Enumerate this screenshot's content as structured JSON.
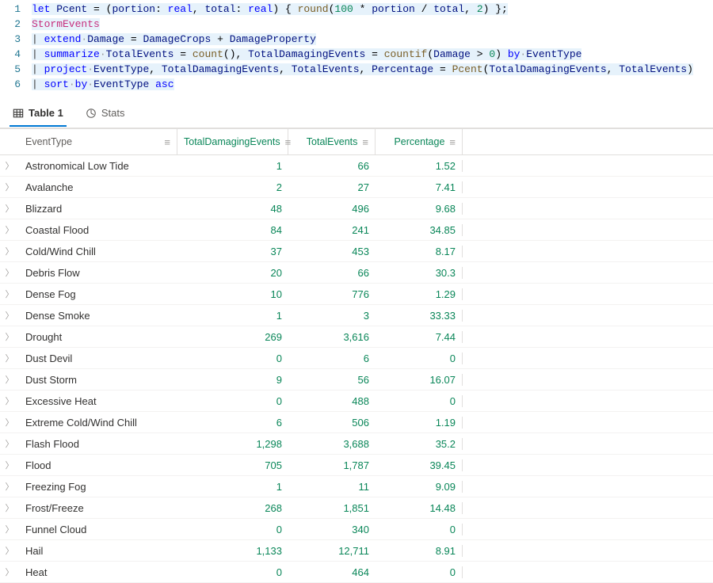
{
  "editor": {
    "lines": [
      {
        "n": "1",
        "tokens": [
          [
            "kw",
            "let"
          ],
          [
            "op",
            " "
          ],
          [
            "ident",
            "Pcent"
          ],
          [
            "op",
            " = ("
          ],
          [
            "ident",
            "portion"
          ],
          [
            "op",
            ": "
          ],
          [
            "kw",
            "real"
          ],
          [
            "op",
            ", "
          ],
          [
            "ident",
            "total"
          ],
          [
            "op",
            ": "
          ],
          [
            "kw",
            "real"
          ],
          [
            "op",
            ") { "
          ],
          [
            "fn",
            "round"
          ],
          [
            "op",
            "("
          ],
          [
            "num",
            "100"
          ],
          [
            "op",
            " * "
          ],
          [
            "ident",
            "portion"
          ],
          [
            "op",
            " / "
          ],
          [
            "ident",
            "total"
          ],
          [
            "op",
            ", "
          ],
          [
            "num",
            "2"
          ],
          [
            "op",
            ") };"
          ]
        ],
        "hl": true
      },
      {
        "n": "2",
        "tokens": [
          [
            "tbl",
            "StormEvents"
          ]
        ],
        "hl": true
      },
      {
        "n": "3",
        "tokens": [
          [
            "pipe",
            "| "
          ],
          [
            "kw",
            "extend"
          ],
          [
            "dot",
            "·"
          ],
          [
            "col",
            "Damage"
          ],
          [
            "op",
            " = "
          ],
          [
            "col",
            "DamageCrops"
          ],
          [
            "op",
            " + "
          ],
          [
            "col",
            "DamageProperty"
          ]
        ],
        "hl": true
      },
      {
        "n": "4",
        "tokens": [
          [
            "pipe",
            "| "
          ],
          [
            "kw",
            "summarize"
          ],
          [
            "dot",
            "·"
          ],
          [
            "col",
            "TotalEvents"
          ],
          [
            "op",
            " = "
          ],
          [
            "fn",
            "count"
          ],
          [
            "op",
            "(), "
          ],
          [
            "col",
            "TotalDamagingEvents"
          ],
          [
            "op",
            " = "
          ],
          [
            "fn",
            "countif"
          ],
          [
            "op",
            "("
          ],
          [
            "col",
            "Damage"
          ],
          [
            "op",
            " > "
          ],
          [
            "num",
            "0"
          ],
          [
            "op",
            ") "
          ],
          [
            "kw",
            "by"
          ],
          [
            "dot",
            "·"
          ],
          [
            "col",
            "EventType"
          ]
        ],
        "hl": true
      },
      {
        "n": "5",
        "tokens": [
          [
            "pipe",
            "| "
          ],
          [
            "kw",
            "project"
          ],
          [
            "dot",
            "·"
          ],
          [
            "col",
            "EventType"
          ],
          [
            "op",
            ", "
          ],
          [
            "col",
            "TotalDamagingEvents"
          ],
          [
            "op",
            ", "
          ],
          [
            "col",
            "TotalEvents"
          ],
          [
            "op",
            ", "
          ],
          [
            "col",
            "Percentage"
          ],
          [
            "op",
            " = "
          ],
          [
            "fn",
            "Pcent"
          ],
          [
            "op",
            "("
          ],
          [
            "col",
            "TotalDamagingEvents"
          ],
          [
            "op",
            ", "
          ],
          [
            "col",
            "TotalEvents"
          ],
          [
            "op",
            ")"
          ]
        ],
        "hl": true
      },
      {
        "n": "6",
        "tokens": [
          [
            "pipe",
            "| "
          ],
          [
            "kw",
            "sort"
          ],
          [
            "dot",
            "·"
          ],
          [
            "kw",
            "by"
          ],
          [
            "dot",
            "·"
          ],
          [
            "col",
            "EventType"
          ],
          [
            "op",
            " "
          ],
          [
            "kw",
            "asc"
          ]
        ],
        "hl": true,
        "partial": true
      }
    ]
  },
  "tabs": {
    "table": "Table 1",
    "stats": "Stats"
  },
  "columns": {
    "eventType": "EventType",
    "totalDamaging": "TotalDamagingEvents",
    "totalEvents": "TotalEvents",
    "percentage": "Percentage"
  },
  "rows": [
    {
      "et": "Astronomical Low Tide",
      "tde": "1",
      "te": "66",
      "pct": "1.52"
    },
    {
      "et": "Avalanche",
      "tde": "2",
      "te": "27",
      "pct": "7.41"
    },
    {
      "et": "Blizzard",
      "tde": "48",
      "te": "496",
      "pct": "9.68"
    },
    {
      "et": "Coastal Flood",
      "tde": "84",
      "te": "241",
      "pct": "34.85"
    },
    {
      "et": "Cold/Wind Chill",
      "tde": "37",
      "te": "453",
      "pct": "8.17"
    },
    {
      "et": "Debris Flow",
      "tde": "20",
      "te": "66",
      "pct": "30.3"
    },
    {
      "et": "Dense Fog",
      "tde": "10",
      "te": "776",
      "pct": "1.29"
    },
    {
      "et": "Dense Smoke",
      "tde": "1",
      "te": "3",
      "pct": "33.33"
    },
    {
      "et": "Drought",
      "tde": "269",
      "te": "3,616",
      "pct": "7.44"
    },
    {
      "et": "Dust Devil",
      "tde": "0",
      "te": "6",
      "pct": "0"
    },
    {
      "et": "Dust Storm",
      "tde": "9",
      "te": "56",
      "pct": "16.07"
    },
    {
      "et": "Excessive Heat",
      "tde": "0",
      "te": "488",
      "pct": "0"
    },
    {
      "et": "Extreme Cold/Wind Chill",
      "tde": "6",
      "te": "506",
      "pct": "1.19"
    },
    {
      "et": "Flash Flood",
      "tde": "1,298",
      "te": "3,688",
      "pct": "35.2"
    },
    {
      "et": "Flood",
      "tde": "705",
      "te": "1,787",
      "pct": "39.45"
    },
    {
      "et": "Freezing Fog",
      "tde": "1",
      "te": "11",
      "pct": "9.09"
    },
    {
      "et": "Frost/Freeze",
      "tde": "268",
      "te": "1,851",
      "pct": "14.48"
    },
    {
      "et": "Funnel Cloud",
      "tde": "0",
      "te": "340",
      "pct": "0"
    },
    {
      "et": "Hail",
      "tde": "1,133",
      "te": "12,711",
      "pct": "8.91"
    },
    {
      "et": "Heat",
      "tde": "0",
      "te": "464",
      "pct": "0"
    }
  ]
}
